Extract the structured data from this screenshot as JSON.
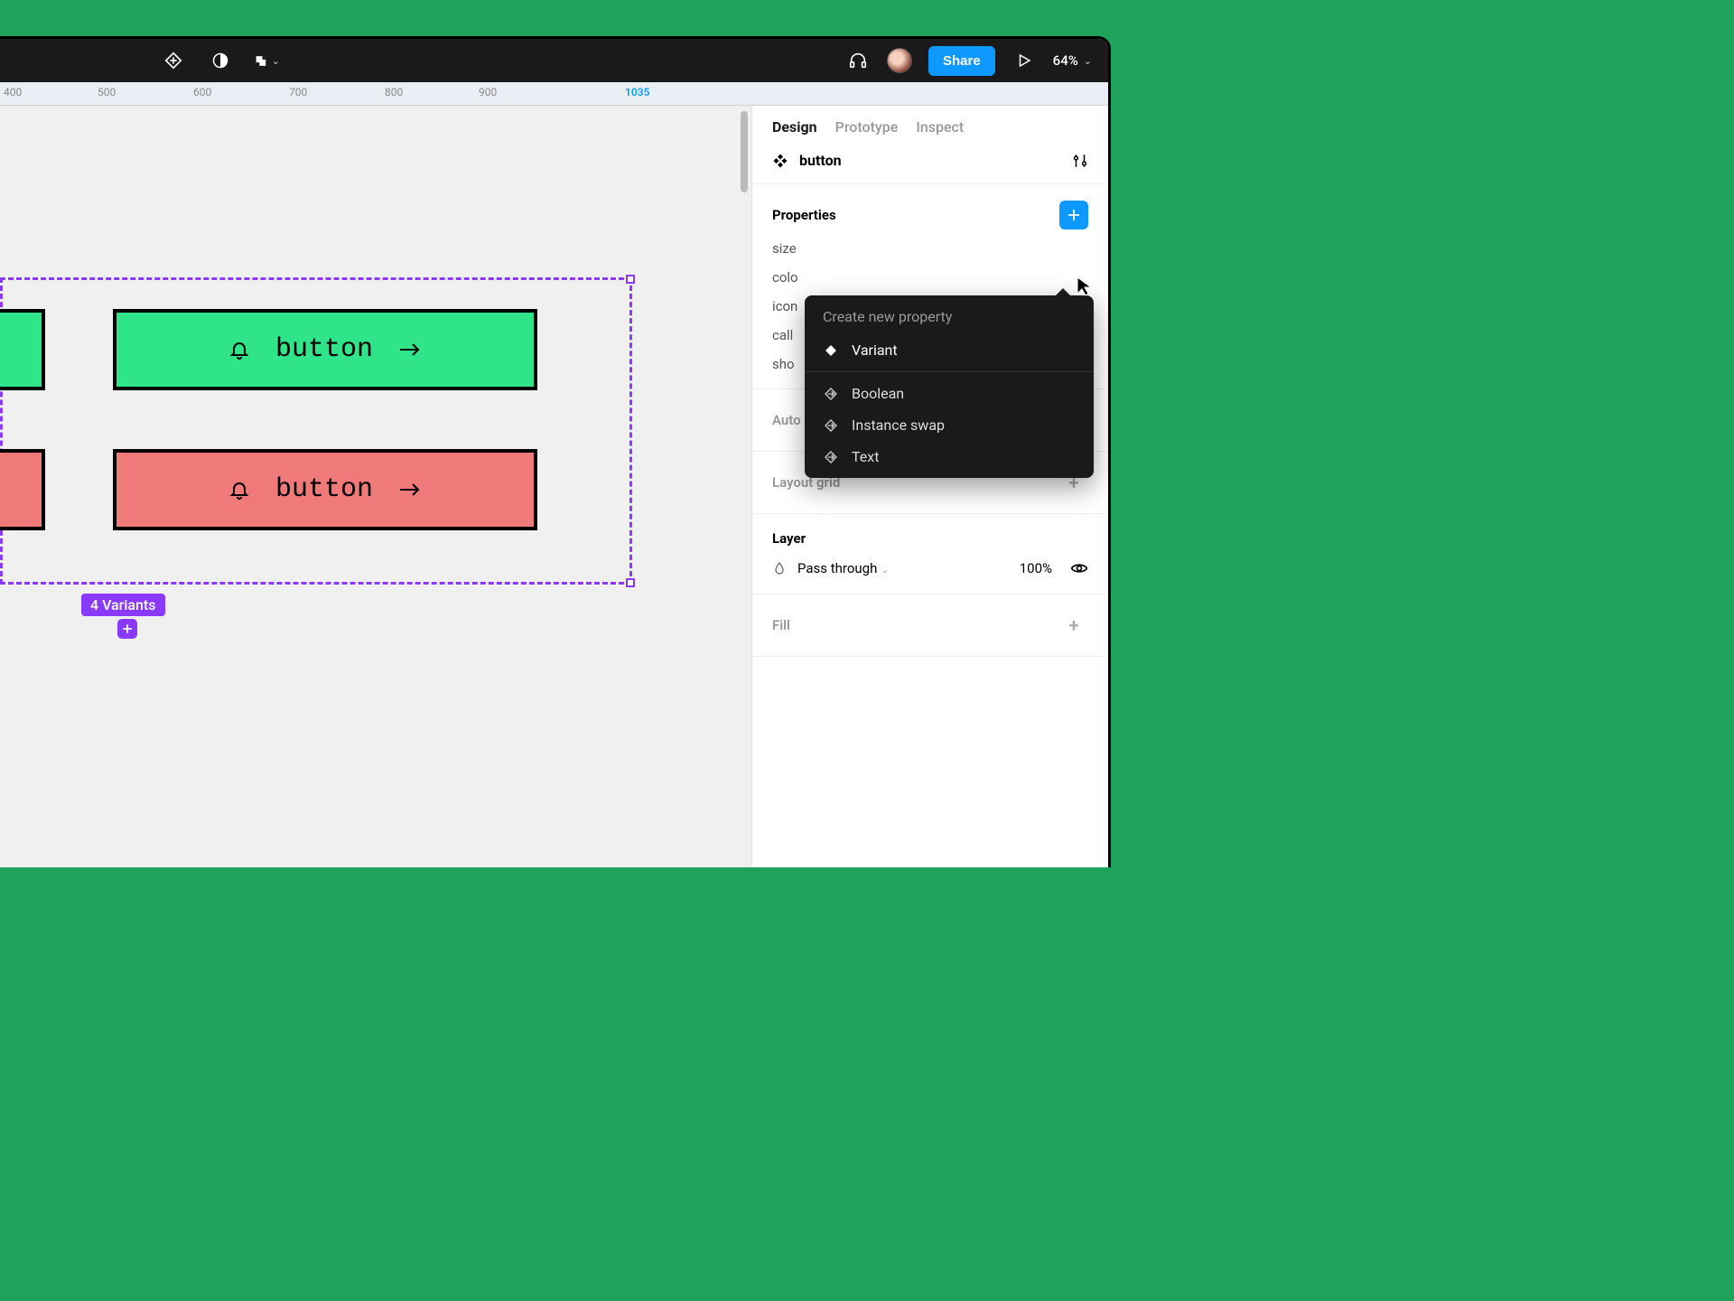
{
  "toolbar": {
    "share_label": "Share",
    "zoom": "64%"
  },
  "ruler": {
    "ticks": [
      "400",
      "500",
      "600",
      "700",
      "800",
      "900"
    ],
    "current": "1035"
  },
  "canvas": {
    "button_label_1": "button",
    "button_label_2": "button",
    "variants_badge": "4 Variants"
  },
  "sidebar": {
    "tabs": {
      "design": "Design",
      "prototype": "Prototype",
      "inspect": "Inspect"
    },
    "component_name": "button",
    "properties_title": "Properties",
    "properties": [
      "size",
      "colo",
      "icon",
      "call",
      "sho"
    ],
    "auto_layout_title": "Auto layout",
    "layout_grid_title": "Layout grid",
    "layer_title": "Layer",
    "layer_blend": "Pass through",
    "layer_opacity": "100%",
    "fill_title": "Fill"
  },
  "popup": {
    "title": "Create new property",
    "variant": "Variant",
    "boolean": "Boolean",
    "instance_swap": "Instance swap",
    "text": "Text"
  }
}
